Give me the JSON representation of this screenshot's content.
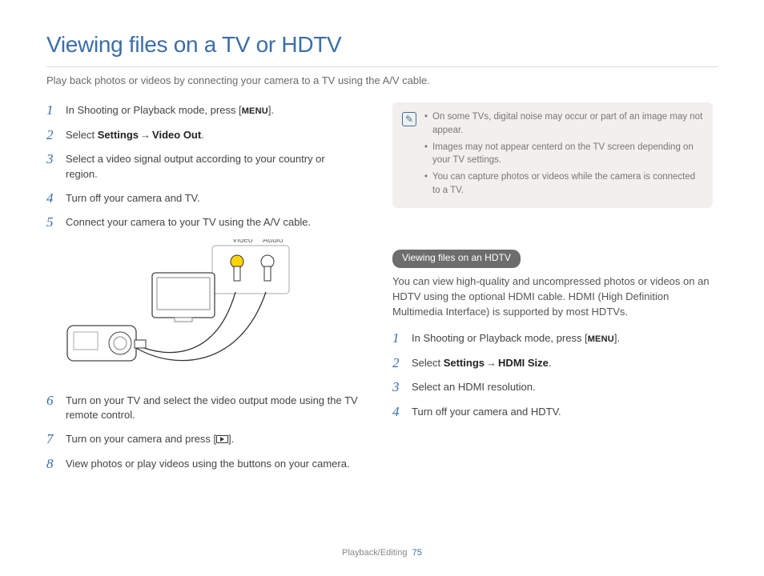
{
  "title": "Viewing files on a TV or HDTV",
  "intro": "Play back photos or videos by connecting your camera to a TV using the A/V cable.",
  "steps_left": [
    {
      "n": "1",
      "pre": "In Shooting or Playback mode, press [",
      "menu": "MENU",
      "post": "]."
    },
    {
      "n": "2",
      "pre": "Select ",
      "b1": "Settings",
      "arrow": " → ",
      "b2": "Video Out",
      "post": "."
    },
    {
      "n": "3",
      "text": "Select a video signal output according to your country or region."
    },
    {
      "n": "4",
      "text": "Turn off your camera and TV."
    },
    {
      "n": "5",
      "text": "Connect your camera to your TV using the A/V cable."
    },
    {
      "n": "6",
      "text": "Turn on your TV and select the video output mode using the TV remote control."
    },
    {
      "n": "7",
      "pre": "Turn on your camera and press [",
      "icon": "play",
      "post": "]."
    },
    {
      "n": "8",
      "text": "View photos or play videos using the buttons on your camera."
    }
  ],
  "diagram": {
    "label_video": "Video",
    "label_audio": "Audio"
  },
  "notes": [
    "On some TVs, digital noise may occur or part of an image may not appear.",
    "Images may not appear centerd on the TV screen depending on your TV settings.",
    "You can capture photos or videos while the camera is connected to a TV."
  ],
  "hdtv": {
    "pill": "Viewing files on an HDTV",
    "para": "You can view high-quality and uncompressed photos or videos on an HDTV using the optional HDMI cable. HDMI (High Definition Multimedia Interface) is supported by most HDTVs.",
    "steps": [
      {
        "n": "1",
        "pre": "In Shooting or Playback mode, press [",
        "menu": "MENU",
        "post": "]."
      },
      {
        "n": "2",
        "pre": "Select ",
        "b1": "Settings",
        "arrow": " → ",
        "b2": "HDMI Size",
        "post": "."
      },
      {
        "n": "3",
        "text": "Select an HDMI resolution."
      },
      {
        "n": "4",
        "text": "Turn off your camera and HDTV."
      }
    ]
  },
  "footer": {
    "section": "Playback/Editing",
    "page": "75"
  }
}
